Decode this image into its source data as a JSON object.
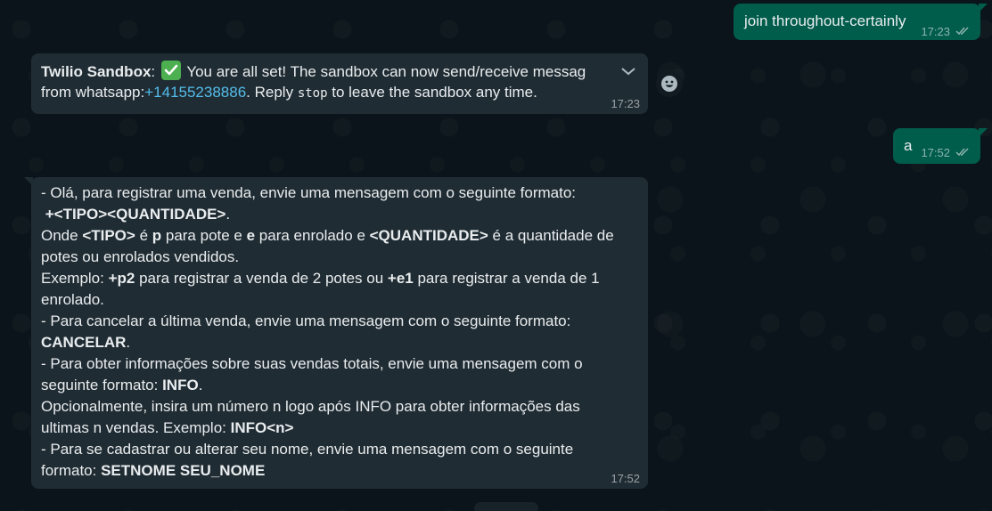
{
  "messages": {
    "m1": {
      "text": "join throughout-certainly",
      "time": "17:23",
      "ticks": "//"
    },
    "m2": {
      "sender": "Twilio Sandbox",
      "colon": ":",
      "text1": "You are all set! The sandbox can now send/receive messag",
      "text2a": "from whatsapp:",
      "phone": "+14155238886",
      "text2b": ". Reply ",
      "stop": "stop",
      "text2c": " to leave the sandbox any time.",
      "time": "17:23"
    },
    "m3": {
      "text": "a",
      "time": "17:52",
      "ticks": "//"
    },
    "m4": {
      "l1": "- Olá, para registrar uma venda, envie uma mensagem com o seguinte formato:",
      "l2": " +<TIPO><QUANTIDADE>",
      "l2_end": ".",
      "l3_a": "Onde ",
      "l3_b": "<TIPO>",
      "l3_c": " é ",
      "l3_d": "p",
      "l3_e": " para pote e ",
      "l3_f": "e",
      "l3_g": " para enrolado e ",
      "l3_h": "<QUANTIDADE>",
      "l3_i": " é a quantidade de",
      "l4": "potes ou enrolados vendidos.",
      "l5_a": "Exemplo: ",
      "l5_b": "+p2",
      "l5_c": " para registrar a venda de 2 potes ou ",
      "l5_d": "+e1",
      "l5_e": " para registrar a venda de 1",
      "l6": "enrolado.",
      "l7": "- Para cancelar a última venda, envie uma mensagem com o seguinte formato:",
      "l8": "CANCELAR",
      "l8_end": ".",
      "l9": "- Para obter informações sobre suas vendas totais, envie uma mensagem com o",
      "l10_a": "seguinte formato: ",
      "l10_b": "INFO",
      "l10_c": ".",
      "l11": "Opcionalmente, insira um número n logo após INFO para obter informações das",
      "l12_a": "ultimas n vendas. Exemplo: ",
      "l12_b": "INFO<n>",
      "l13": "- Para se cadastrar ou alterar seu nome, envie uma mensagem com o seguinte",
      "l14_a": "formato: ",
      "l14_b": "SETNOME SEU_NOME",
      "time": "17:52"
    }
  },
  "colors": {
    "background": "#0b141a",
    "incoming": "#202c33",
    "outgoing": "#005c4b",
    "link": "#53bdeb",
    "emoji": "#4caf50"
  },
  "icons": [
    "check-emoji-icon",
    "chevron-down-icon",
    "smiley-icon",
    "double-check-icon"
  ]
}
